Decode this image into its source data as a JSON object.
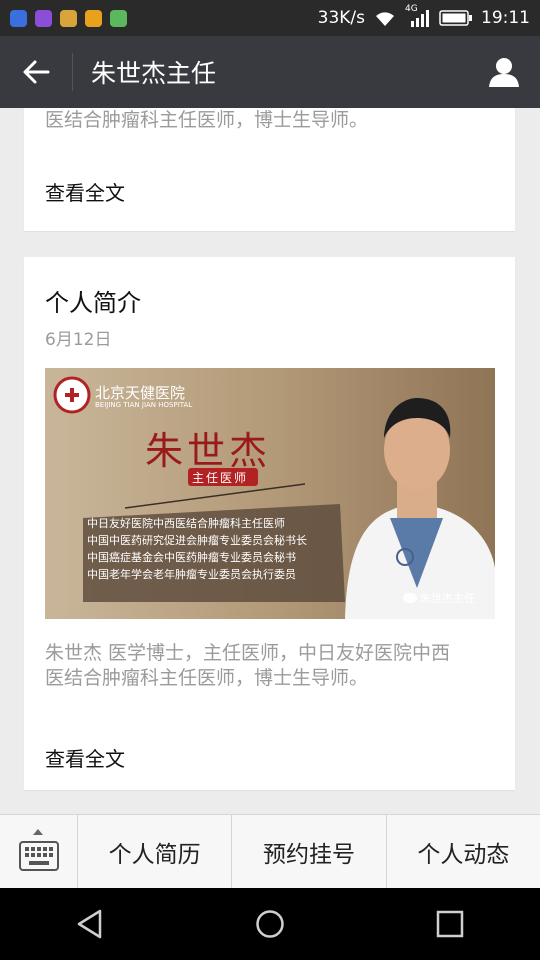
{
  "status_bar": {
    "speed": "33K/s",
    "network": "4G",
    "time": "19:11"
  },
  "nav": {
    "title": "朱世杰主任"
  },
  "card1": {
    "summary": "医结合肿瘤科主任医师，博士生导师。",
    "read_more": "查看全文"
  },
  "card2": {
    "title": "个人简介",
    "date": "6月12日",
    "cover": {
      "hospital_cn": "北京天健医院",
      "hospital_en": "BEIJING TIAN JIAN HOSPITAL",
      "doctor_name": "朱世杰",
      "doctor_role": "主任医师",
      "credentials": [
        "中日友好医院中西医结合肿瘤科主任医师",
        "中国中医药研究促进会肿瘤专业委员会秘书长",
        "中国癌症基金会中医药肿瘤专业委员会秘书",
        "中国老年学会老年肿瘤专业委员会执行委员"
      ],
      "watermark": "朱世杰主任"
    },
    "summary_line1": "朱世杰 医学博士，主任医师，中日友好医院中西",
    "summary_line2": "医结合肿瘤科主任医师，博士生导师。",
    "read_more": "查看全文"
  },
  "menu": {
    "items": [
      "个人简历",
      "预约挂号",
      "个人动态"
    ]
  },
  "colors": {
    "nav_bg": "#393a3f",
    "status_bg": "#2a2a2a",
    "accent_red": "#b22222"
  }
}
